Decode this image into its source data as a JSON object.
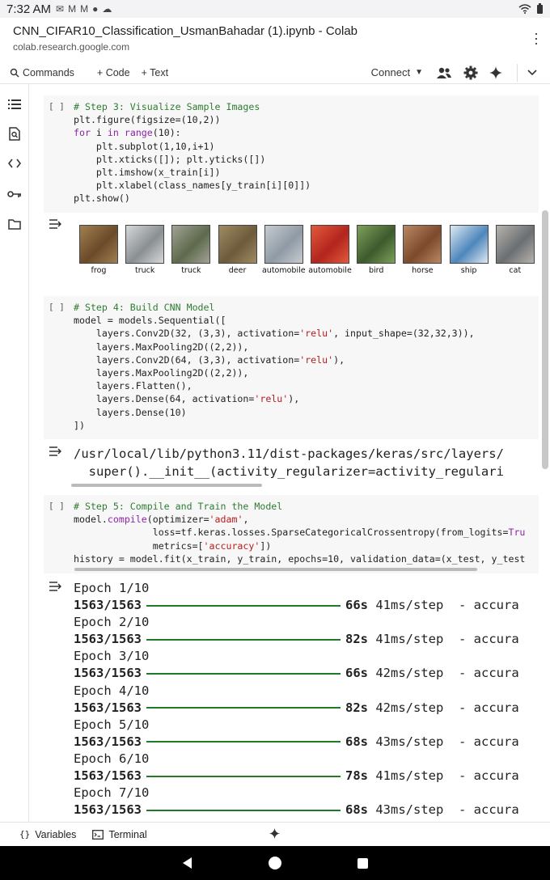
{
  "status": {
    "time": "7:32 AM",
    "icons": [
      "mail-icon",
      "gmail-icon",
      "gmail-icon",
      "app-icon",
      "cloud-icon"
    ]
  },
  "browser": {
    "title": "CNN_CIFAR10_Classification_UsmanBahadar (1).ipynb - Colab",
    "url": "colab.research.google.com"
  },
  "toolbar": {
    "commands": "Commands",
    "code": "+ Code",
    "text": "+ Text",
    "connect": "Connect"
  },
  "cells": [
    {
      "bracket": "[ ]",
      "lines": [
        [
          [
            "cm",
            "# Step 3: Visualize Sample Images"
          ]
        ],
        [
          [
            "fn",
            "plt.figure(figsize=(10,2))"
          ]
        ],
        [
          [
            "kw",
            "for"
          ],
          [
            "fn",
            " i "
          ],
          [
            "kw",
            "in"
          ],
          [
            "fn",
            " "
          ],
          [
            "kw",
            "range"
          ],
          [
            "fn",
            "(10):"
          ]
        ],
        [
          [
            "fn",
            "    plt.subplot(1,10,i+1)"
          ]
        ],
        [
          [
            "fn",
            "    plt.xticks([]); plt.yticks([])"
          ]
        ],
        [
          [
            "fn",
            "    plt.imshow(x_train[i])"
          ]
        ],
        [
          [
            "fn",
            "    plt.xlabel(class_names[y_train[i][0]])"
          ]
        ],
        [
          [
            "fn",
            "plt.show()"
          ]
        ]
      ]
    },
    {
      "bracket": "[ ]",
      "lines": [
        [
          [
            "cm",
            "# Step 4: Build CNN Model"
          ]
        ],
        [
          [
            "fn",
            "model = models.Sequential(["
          ]
        ],
        [
          [
            "fn",
            "    layers.Conv2D(32, (3,3), activation="
          ],
          [
            "st",
            "'relu'"
          ],
          [
            "fn",
            ", input_shape=(32,32,3)),"
          ]
        ],
        [
          [
            "fn",
            "    layers.MaxPooling2D((2,2)),"
          ]
        ],
        [
          [
            "fn",
            "    layers.Conv2D(64, (3,3), activation="
          ],
          [
            "st",
            "'relu'"
          ],
          [
            "fn",
            "),"
          ]
        ],
        [
          [
            "fn",
            "    layers.MaxPooling2D((2,2)),"
          ]
        ],
        [
          [
            "fn",
            "    layers.Flatten(),"
          ]
        ],
        [
          [
            "fn",
            "    layers.Dense(64, activation="
          ],
          [
            "st",
            "'relu'"
          ],
          [
            "fn",
            "),"
          ]
        ],
        [
          [
            "fn",
            "    layers.Dense(10)"
          ]
        ],
        [
          [
            "fn",
            "])"
          ]
        ]
      ]
    },
    {
      "bracket": "[ ]",
      "lines": [
        [
          [
            "cm",
            "# Step 5: Compile and Train the Model"
          ]
        ],
        [
          [
            "fn",
            "model."
          ],
          [
            "kw",
            "compile"
          ],
          [
            "fn",
            "(optimizer="
          ],
          [
            "st",
            "'adam'"
          ],
          [
            "fn",
            ","
          ]
        ],
        [
          [
            "fn",
            "              loss=tf.keras.losses.SparseCategoricalCrossentropy(from_logits="
          ],
          [
            "kw",
            "Tru"
          ]
        ],
        [
          [
            "fn",
            "              metrics=["
          ],
          [
            "st",
            "'accuracy'"
          ],
          [
            "fn",
            "])"
          ]
        ],
        [
          [
            "fn",
            "history = model.fit(x_train, y_train, epochs=10, validation_data=(x_test, y_test"
          ]
        ]
      ]
    }
  ],
  "sample_labels": [
    "frog",
    "truck",
    "truck",
    "deer",
    "automobile",
    "automobile",
    "bird",
    "horse",
    "ship",
    "cat"
  ],
  "sample_colors": [
    [
      "#6b4a2a",
      "#a08050"
    ],
    [
      "#8a8f92",
      "#d7d9dc"
    ],
    [
      "#5d6a4c",
      "#a3a295"
    ],
    [
      "#6c5a3c",
      "#a08c62"
    ],
    [
      "#8f9aa5",
      "#c8ccd0"
    ],
    [
      "#b3241d",
      "#e25a3c"
    ],
    [
      "#3c5a2c",
      "#7ea05a"
    ],
    [
      "#7c4a2c",
      "#b98862"
    ],
    [
      "#4d86bc",
      "#dfe9f2"
    ],
    [
      "#6a6f72",
      "#b8b3ad"
    ]
  ],
  "warning": {
    "line1": "/usr/local/lib/python3.11/dist-packages/keras/src/layers/",
    "line2": "  super().__init__(activity_regularizer=activity_regulari"
  },
  "epochs": [
    {
      "epoch": "Epoch 1/10",
      "progress": "1563/1563",
      "time": "66s",
      "step": "41ms/step",
      "tail": "- accura"
    },
    {
      "epoch": "Epoch 2/10",
      "progress": "1563/1563",
      "time": "82s",
      "step": "41ms/step",
      "tail": "- accura"
    },
    {
      "epoch": "Epoch 3/10",
      "progress": "1563/1563",
      "time": "66s",
      "step": "42ms/step",
      "tail": "- accura"
    },
    {
      "epoch": "Epoch 4/10",
      "progress": "1563/1563",
      "time": "82s",
      "step": "42ms/step",
      "tail": "- accura"
    },
    {
      "epoch": "Epoch 5/10",
      "progress": "1563/1563",
      "time": "68s",
      "step": "43ms/step",
      "tail": "- accura"
    },
    {
      "epoch": "Epoch 6/10",
      "progress": "1563/1563",
      "time": "78s",
      "step": "41ms/step",
      "tail": "- accura"
    },
    {
      "epoch": "Epoch 7/10",
      "progress": "1563/1563",
      "time": "68s",
      "step": "43ms/step",
      "tail": "- accura"
    }
  ],
  "bottom": {
    "variables": "Variables",
    "terminal": "Terminal"
  },
  "colors": {
    "progress_bar": "#1e7a25",
    "comment": "#2e7d32",
    "keyword": "#8e24aa",
    "string": "#b71c1c"
  }
}
